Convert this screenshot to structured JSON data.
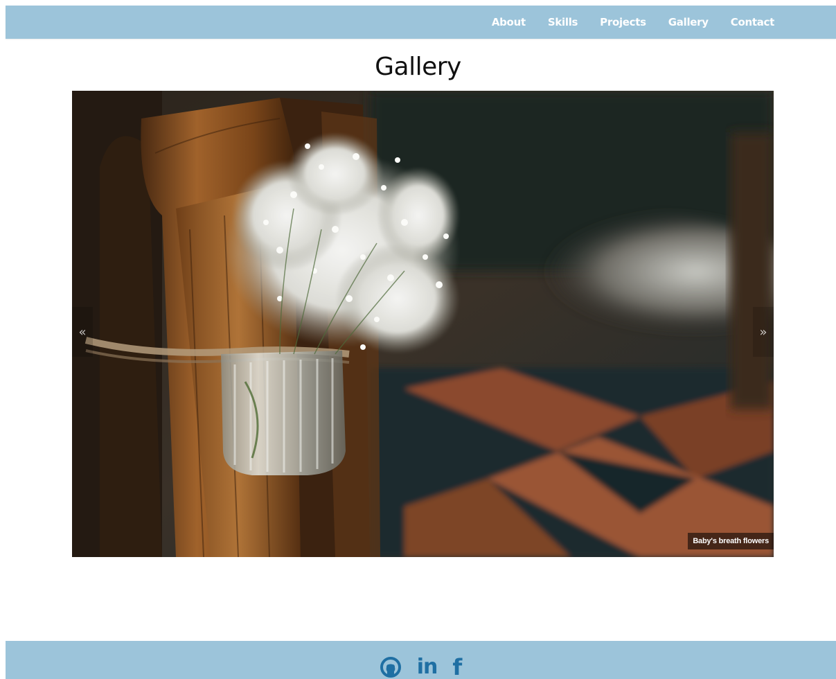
{
  "nav": {
    "links": [
      "About",
      "Skills",
      "Projects",
      "Gallery",
      "Contact"
    ]
  },
  "main": {
    "title": "Gallery"
  },
  "carousel": {
    "prev_glyph": "«",
    "next_glyph": "»",
    "caption": "Baby's breath flowers",
    "image_description_icon": "flower-jar-photo"
  },
  "footer": {
    "icons": [
      "github-icon",
      "linkedin-icon",
      "facebook-icon"
    ],
    "linkedin_glyph": "in",
    "facebook_glyph": "f"
  },
  "colors": {
    "navbar": "#9cc4da",
    "footer": "#9cc4da",
    "icon": "#1f6fa3"
  }
}
